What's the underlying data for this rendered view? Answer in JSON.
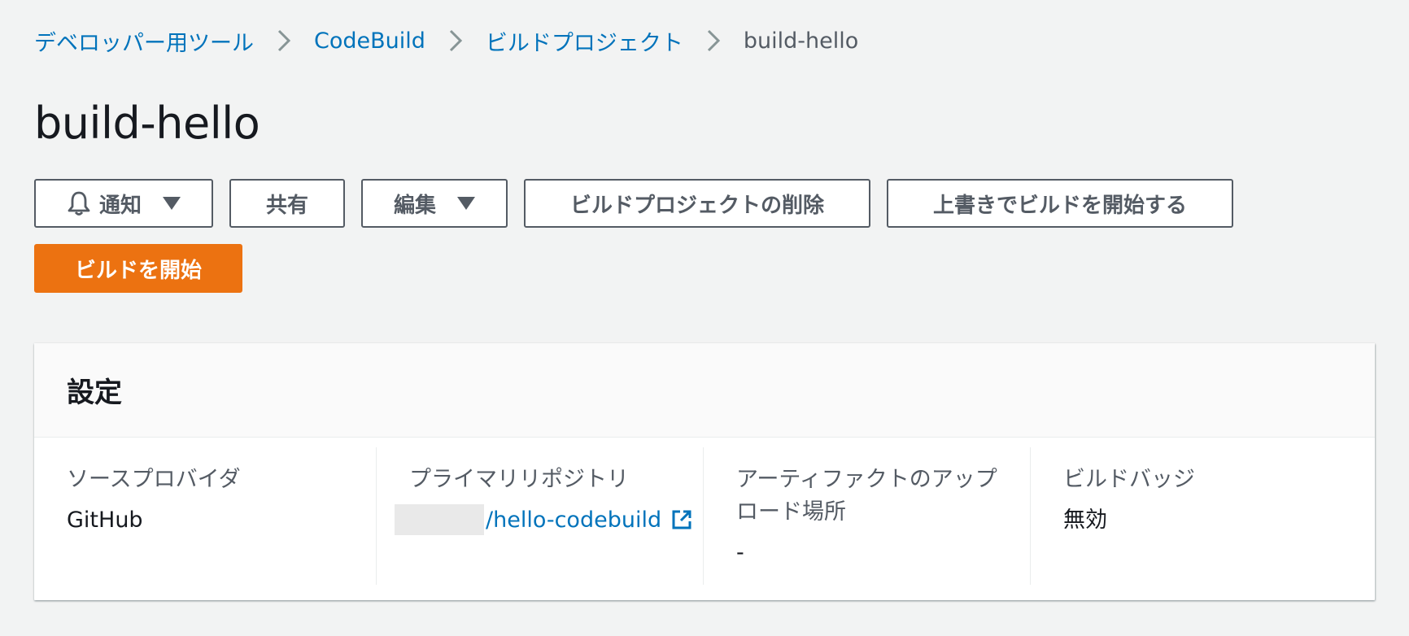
{
  "breadcrumb": {
    "items": [
      "デベロッパー用ツール",
      "CodeBuild",
      "ビルドプロジェクト"
    ],
    "current": "build-hello"
  },
  "page": {
    "title": "build-hello"
  },
  "actions": {
    "notify": "通知",
    "share": "共有",
    "edit": "編集",
    "delete_project": "ビルドプロジェクトの削除",
    "start_with_overrides": "上書きでビルドを開始する",
    "start_build": "ビルドを開始"
  },
  "config": {
    "title": "設定",
    "source_provider": {
      "label": "ソースプロバイダ",
      "value": "GitHub"
    },
    "primary_repo": {
      "label": "プライマリリポジトリ",
      "value": "/hello-codebuild"
    },
    "artifact_upload": {
      "label": "アーティファクトのアップロード場所",
      "value": "-"
    },
    "build_badge": {
      "label": "ビルドバッジ",
      "value": "無効"
    }
  },
  "colors": {
    "link": "#0073bb",
    "primary_button": "#ec7211",
    "page_background": "#f2f3f3"
  },
  "icons": [
    "chevron-right-icon",
    "bell-icon",
    "caret-down-icon",
    "external-link-icon"
  ]
}
